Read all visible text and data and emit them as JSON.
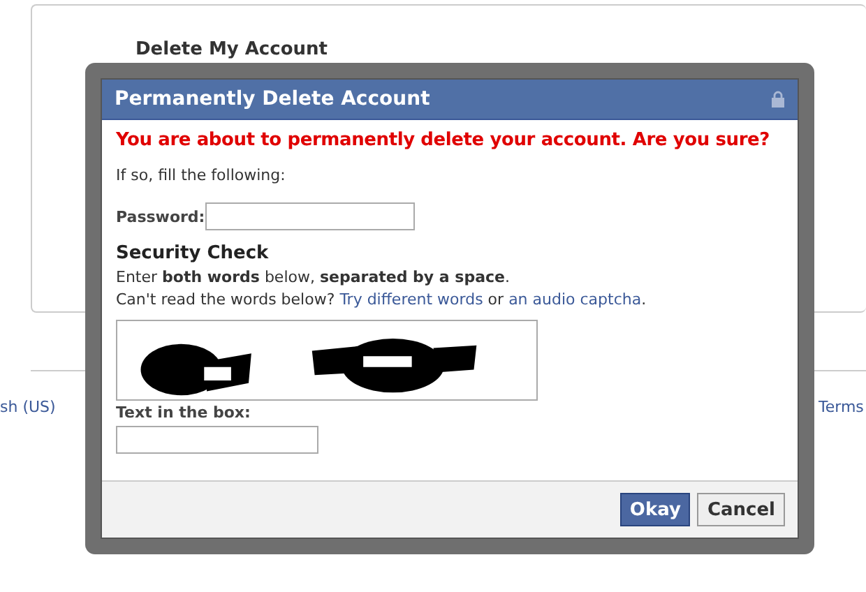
{
  "page": {
    "heading": "Delete My Account",
    "footer_left": "sh (US)",
    "footer_right": "Terms"
  },
  "dialog": {
    "title": "Permanently Delete Account",
    "locked": true,
    "warning": "You are about to permanently delete your account. Are you sure?",
    "instruction": "If so, fill the following:",
    "password": {
      "label": "Password:"
    },
    "security": {
      "heading": "Security Check",
      "instruction": "Enter **both words** below, **separated by a space**.",
      "help": [
        {
          "kind": "text",
          "text": "Can't read the words below? "
        },
        {
          "kind": "link",
          "text": "Try different words"
        },
        {
          "kind": "text",
          "text": " or "
        },
        {
          "kind": "link",
          "text": "an audio captcha"
        },
        {
          "kind": "text",
          "text": "."
        }
      ],
      "answer_label": "Text in the box:"
    },
    "buttons": [
      {
        "label": "Okay",
        "kind": "primary"
      },
      {
        "label": "Cancel",
        "kind": "secondary"
      }
    ]
  }
}
